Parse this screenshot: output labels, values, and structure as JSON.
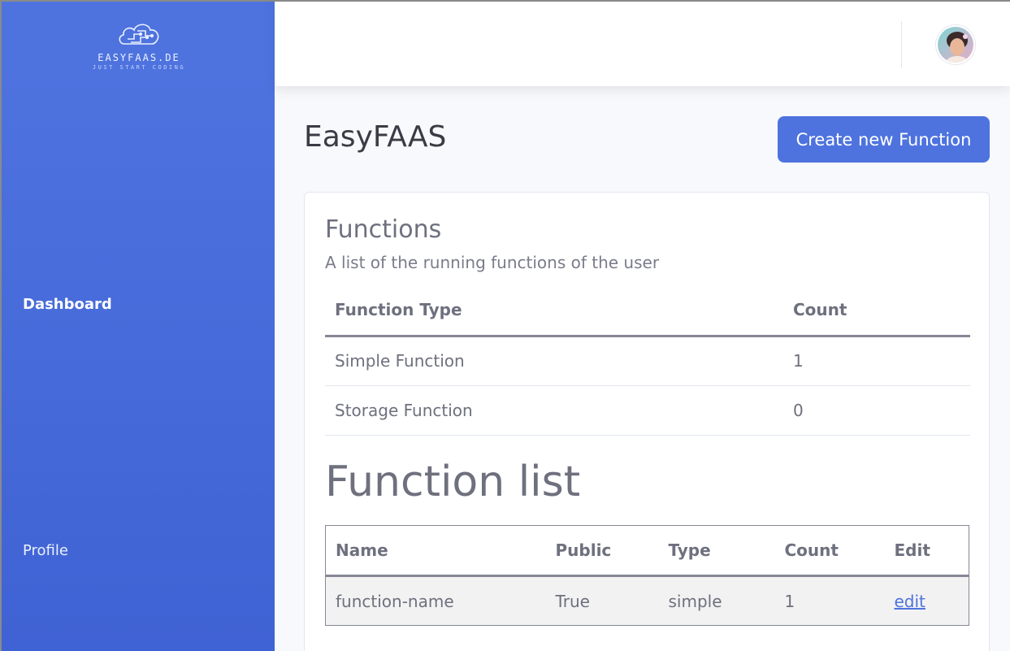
{
  "brand": {
    "name": "EASYFAAS.DE",
    "tagline": "JUST START CODING"
  },
  "sidebar": {
    "items": [
      {
        "label": "Dashboard",
        "active": true
      },
      {
        "label": "Profile",
        "active": false
      }
    ]
  },
  "topbar": {
    "avatar_icon": "user-avatar"
  },
  "page": {
    "title": "EasyFAAS",
    "create_button_label": "Create new Function"
  },
  "functions_card": {
    "title": "Functions",
    "subtitle": "A list of the running functions of the user",
    "columns": [
      "Function Type",
      "Count"
    ],
    "rows": [
      [
        "Simple Function",
        "1"
      ],
      [
        "Storage Function",
        "0"
      ]
    ]
  },
  "function_list": {
    "title": "Function list",
    "columns": [
      "Name",
      "Public",
      "Type",
      "Count",
      "Edit"
    ],
    "rows": [
      {
        "name": "function-name",
        "public": "True",
        "type": "simple",
        "count": "1",
        "edit_label": "edit"
      }
    ]
  },
  "colors": {
    "primary": "#4e73df",
    "text": "#6e707e",
    "background": "#f8f9fc"
  }
}
